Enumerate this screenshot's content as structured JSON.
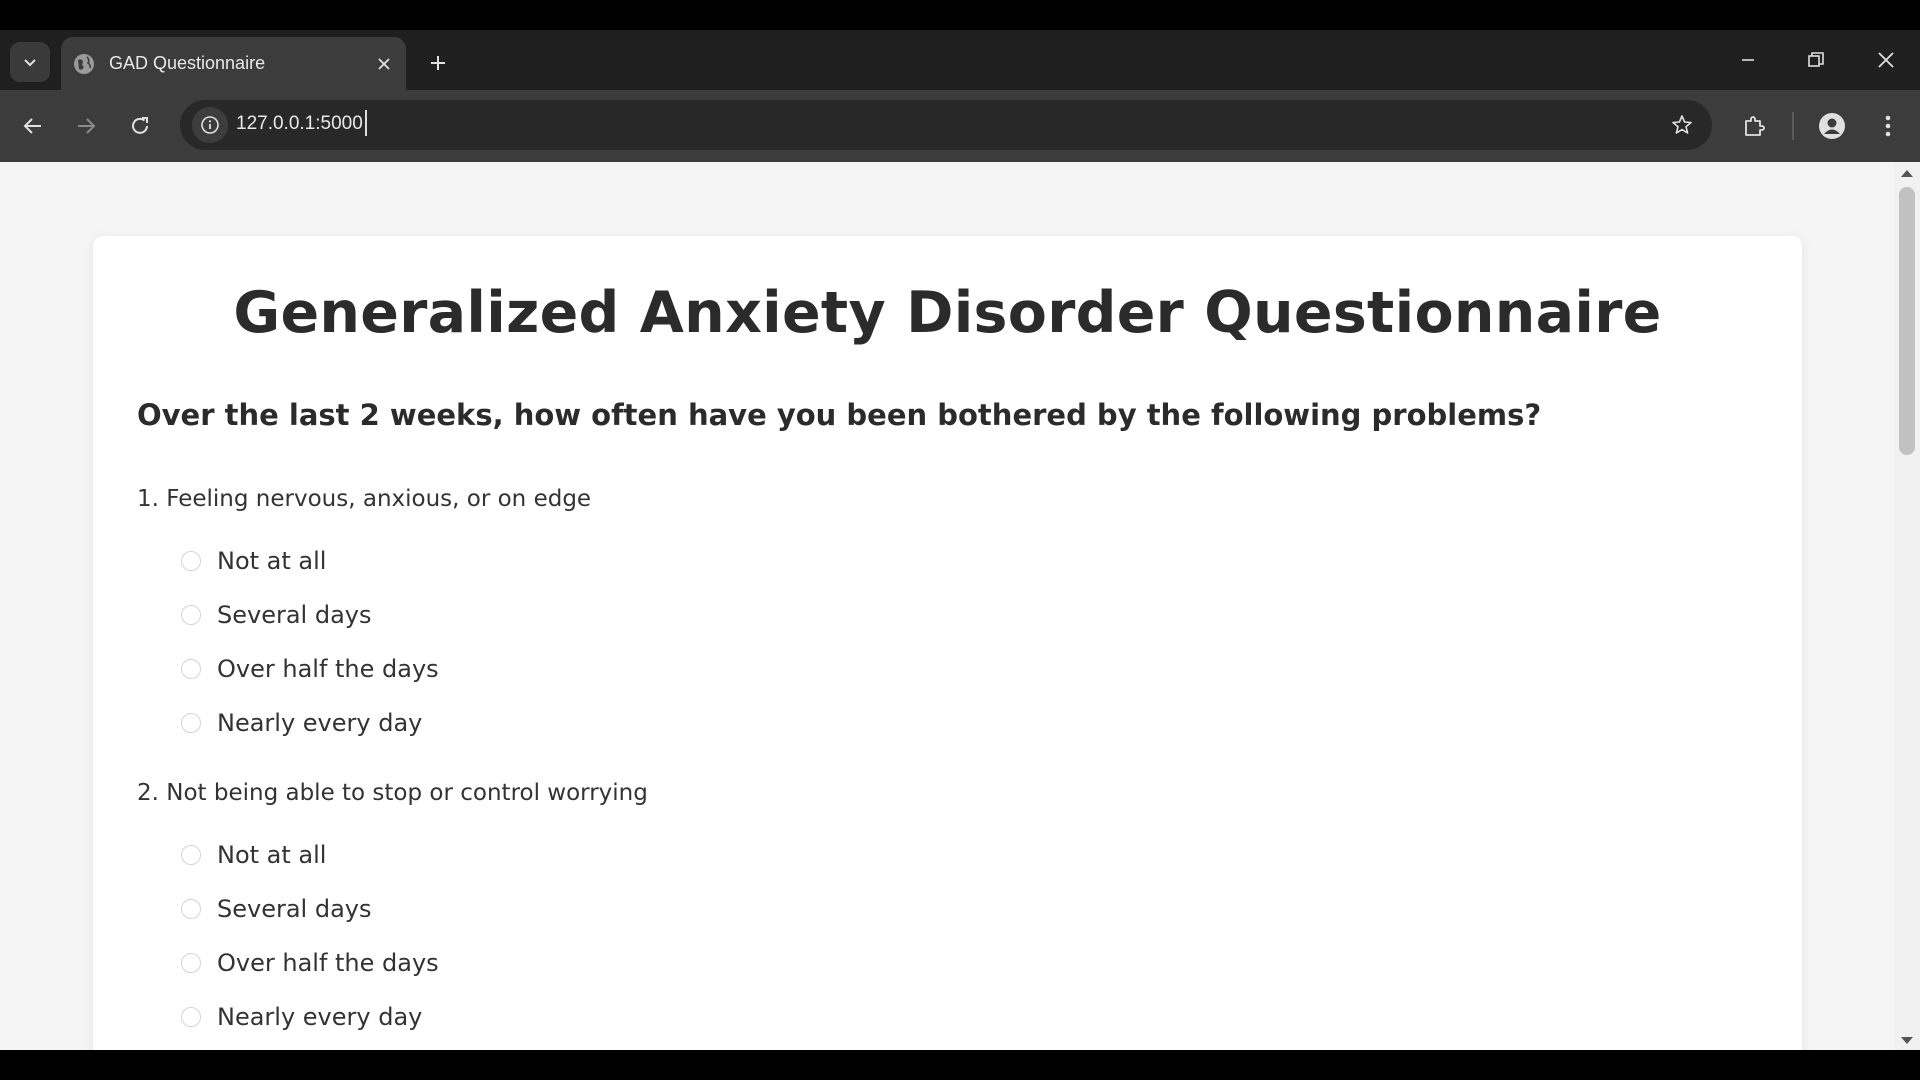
{
  "browser": {
    "tab_title": "GAD Questionnaire",
    "url": "127.0.0.1:5000"
  },
  "page": {
    "title": "Generalized Anxiety Disorder Questionnaire",
    "prompt": "Over the last 2 weeks, how often have you been bothered by the following problems?",
    "questions": [
      {
        "text": "1. Feeling nervous, anxious, or on edge",
        "options": [
          "Not at all",
          "Several days",
          "Over half the days",
          "Nearly every day"
        ]
      },
      {
        "text": "2. Not being able to stop or control worrying",
        "options": [
          "Not at all",
          "Several days",
          "Over half the days",
          "Nearly every day"
        ]
      }
    ]
  }
}
